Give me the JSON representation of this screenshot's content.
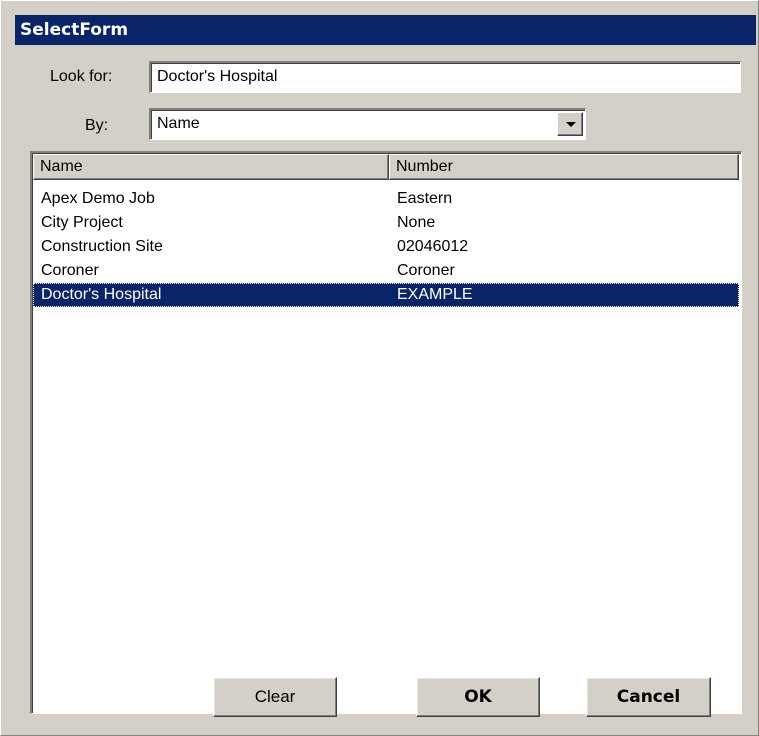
{
  "window": {
    "title": "SelectForm"
  },
  "search": {
    "look_for_label": "Look for:",
    "look_for_value": "Doctor's Hospital",
    "by_label": "By:",
    "by_value": "Name"
  },
  "list": {
    "columns": [
      "Name",
      "Number"
    ],
    "rows": [
      {
        "name": "Apex Demo Job",
        "number": "Eastern",
        "selected": false
      },
      {
        "name": "City Project",
        "number": "None",
        "selected": false
      },
      {
        "name": "Construction Site",
        "number": "02046012",
        "selected": false
      },
      {
        "name": "Coroner",
        "number": "Coroner",
        "selected": false
      },
      {
        "name": "Doctor's Hospital",
        "number": "EXAMPLE",
        "selected": true
      }
    ]
  },
  "buttons": {
    "clear": "Clear",
    "ok": "OK",
    "cancel": "Cancel"
  },
  "colors": {
    "titlebar": "#0a246a",
    "selection": "#0a246a",
    "face": "#d4d0c8"
  },
  "icons": {
    "dropdown": "chevron-down-icon"
  }
}
